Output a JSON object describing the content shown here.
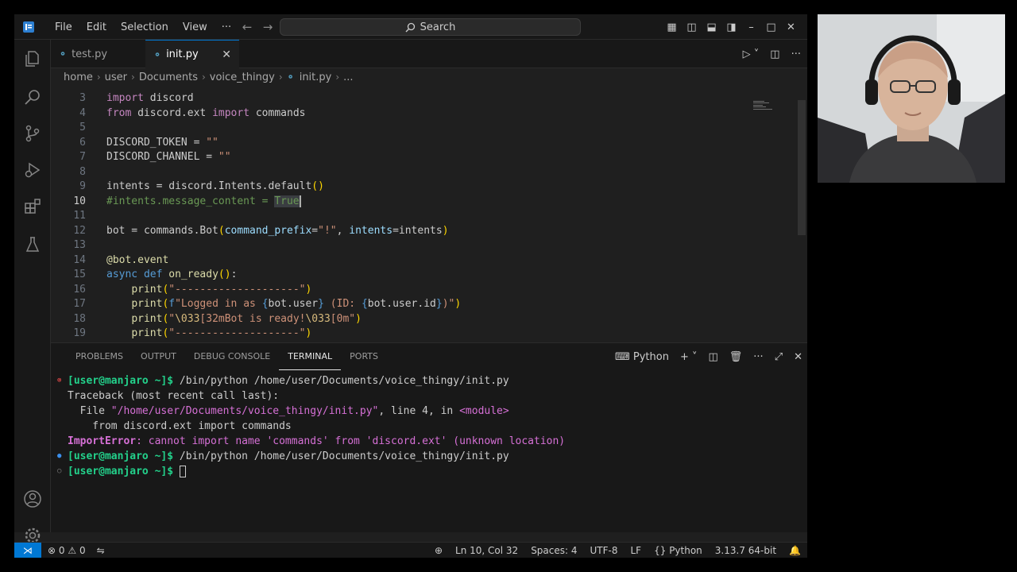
{
  "titlebar": {
    "menu": [
      "File",
      "Edit",
      "Selection",
      "View",
      "···"
    ],
    "search_placeholder": "Search"
  },
  "tabs": [
    {
      "label": "test.py",
      "active": false
    },
    {
      "label": "init.py",
      "active": true
    }
  ],
  "breadcrumb": [
    "home",
    "user",
    "Documents",
    "voice_thingy",
    "init.py",
    "..."
  ],
  "editor": {
    "lines": [
      {
        "n": "3",
        "text": "import discord"
      },
      {
        "n": "4",
        "text": "from discord.ext import commands"
      },
      {
        "n": "5",
        "text": ""
      },
      {
        "n": "6",
        "text": "DISCORD_TOKEN = \"\""
      },
      {
        "n": "7",
        "text": "DISCORD_CHANNEL = \"\""
      },
      {
        "n": "8",
        "text": ""
      },
      {
        "n": "9",
        "text": "intents = discord.Intents.default()"
      },
      {
        "n": "10",
        "text": "#intents.message_content = True"
      },
      {
        "n": "11",
        "text": ""
      },
      {
        "n": "12",
        "text": "bot = commands.Bot(command_prefix=\"!\", intents=intents)"
      },
      {
        "n": "13",
        "text": ""
      },
      {
        "n": "14",
        "text": "@bot.event"
      },
      {
        "n": "15",
        "text": "async def on_ready():"
      },
      {
        "n": "16",
        "text": "    print(\"--------------------\")"
      },
      {
        "n": "17",
        "text": "    print(f\"Logged in as {bot.user} (ID: {bot.user.id})\")"
      },
      {
        "n": "18",
        "text": "    print(\"\\033[32mBot is ready!\\033[0m\")"
      },
      {
        "n": "19",
        "text": "    print(\"--------------------\")"
      }
    ],
    "current_line": "10"
  },
  "panel": {
    "tabs": [
      "PROBLEMS",
      "OUTPUT",
      "DEBUG CONSOLE",
      "TERMINAL",
      "PORTS"
    ],
    "active_tab": "TERMINAL",
    "terminal_profile": "Python",
    "terminal": {
      "prompt": "[user@manjaro ~]$",
      "command": " /bin/python /home/user/Documents/voice_thingy/init.py",
      "traceback_header": "Traceback (most recent call last):",
      "file_label": "  File ",
      "file_path": "\"/home/user/Documents/voice_thingy/init.py\"",
      "file_line": ", line 4, in ",
      "file_module": "<module>",
      "code_line": "    from discord.ext import commands",
      "error_type": "ImportError",
      "error_msg": ": cannot import name 'commands' from 'discord.ext' (unknown location)"
    }
  },
  "statusbar": {
    "errors": "0",
    "warnings": "0",
    "cursor_pos": "Ln 10, Col 32",
    "spaces": "Spaces: 4",
    "encoding": "UTF-8",
    "eol": "LF",
    "language": "Python",
    "interpreter": "3.13.7 64-bit"
  },
  "colors": {
    "accent": "#0078d4",
    "background": "#1f1f1f",
    "terminal_prompt": "#23d18b",
    "error": "#d670d6"
  }
}
